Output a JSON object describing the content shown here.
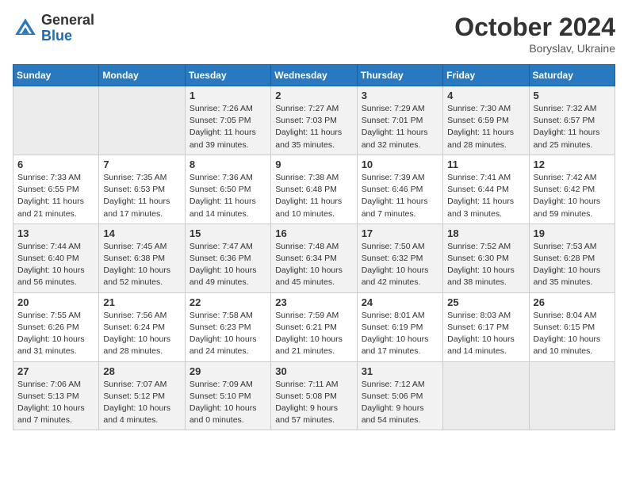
{
  "header": {
    "logo_general": "General",
    "logo_blue": "Blue",
    "month": "October 2024",
    "location": "Boryslav, Ukraine"
  },
  "weekdays": [
    "Sunday",
    "Monday",
    "Tuesday",
    "Wednesday",
    "Thursday",
    "Friday",
    "Saturday"
  ],
  "weeks": [
    [
      {
        "day": "",
        "info": ""
      },
      {
        "day": "",
        "info": ""
      },
      {
        "day": "1",
        "info": "Sunrise: 7:26 AM\nSunset: 7:05 PM\nDaylight: 11 hours and 39 minutes."
      },
      {
        "day": "2",
        "info": "Sunrise: 7:27 AM\nSunset: 7:03 PM\nDaylight: 11 hours and 35 minutes."
      },
      {
        "day": "3",
        "info": "Sunrise: 7:29 AM\nSunset: 7:01 PM\nDaylight: 11 hours and 32 minutes."
      },
      {
        "day": "4",
        "info": "Sunrise: 7:30 AM\nSunset: 6:59 PM\nDaylight: 11 hours and 28 minutes."
      },
      {
        "day": "5",
        "info": "Sunrise: 7:32 AM\nSunset: 6:57 PM\nDaylight: 11 hours and 25 minutes."
      }
    ],
    [
      {
        "day": "6",
        "info": "Sunrise: 7:33 AM\nSunset: 6:55 PM\nDaylight: 11 hours and 21 minutes."
      },
      {
        "day": "7",
        "info": "Sunrise: 7:35 AM\nSunset: 6:53 PM\nDaylight: 11 hours and 17 minutes."
      },
      {
        "day": "8",
        "info": "Sunrise: 7:36 AM\nSunset: 6:50 PM\nDaylight: 11 hours and 14 minutes."
      },
      {
        "day": "9",
        "info": "Sunrise: 7:38 AM\nSunset: 6:48 PM\nDaylight: 11 hours and 10 minutes."
      },
      {
        "day": "10",
        "info": "Sunrise: 7:39 AM\nSunset: 6:46 PM\nDaylight: 11 hours and 7 minutes."
      },
      {
        "day": "11",
        "info": "Sunrise: 7:41 AM\nSunset: 6:44 PM\nDaylight: 11 hours and 3 minutes."
      },
      {
        "day": "12",
        "info": "Sunrise: 7:42 AM\nSunset: 6:42 PM\nDaylight: 10 hours and 59 minutes."
      }
    ],
    [
      {
        "day": "13",
        "info": "Sunrise: 7:44 AM\nSunset: 6:40 PM\nDaylight: 10 hours and 56 minutes."
      },
      {
        "day": "14",
        "info": "Sunrise: 7:45 AM\nSunset: 6:38 PM\nDaylight: 10 hours and 52 minutes."
      },
      {
        "day": "15",
        "info": "Sunrise: 7:47 AM\nSunset: 6:36 PM\nDaylight: 10 hours and 49 minutes."
      },
      {
        "day": "16",
        "info": "Sunrise: 7:48 AM\nSunset: 6:34 PM\nDaylight: 10 hours and 45 minutes."
      },
      {
        "day": "17",
        "info": "Sunrise: 7:50 AM\nSunset: 6:32 PM\nDaylight: 10 hours and 42 minutes."
      },
      {
        "day": "18",
        "info": "Sunrise: 7:52 AM\nSunset: 6:30 PM\nDaylight: 10 hours and 38 minutes."
      },
      {
        "day": "19",
        "info": "Sunrise: 7:53 AM\nSunset: 6:28 PM\nDaylight: 10 hours and 35 minutes."
      }
    ],
    [
      {
        "day": "20",
        "info": "Sunrise: 7:55 AM\nSunset: 6:26 PM\nDaylight: 10 hours and 31 minutes."
      },
      {
        "day": "21",
        "info": "Sunrise: 7:56 AM\nSunset: 6:24 PM\nDaylight: 10 hours and 28 minutes."
      },
      {
        "day": "22",
        "info": "Sunrise: 7:58 AM\nSunset: 6:23 PM\nDaylight: 10 hours and 24 minutes."
      },
      {
        "day": "23",
        "info": "Sunrise: 7:59 AM\nSunset: 6:21 PM\nDaylight: 10 hours and 21 minutes."
      },
      {
        "day": "24",
        "info": "Sunrise: 8:01 AM\nSunset: 6:19 PM\nDaylight: 10 hours and 17 minutes."
      },
      {
        "day": "25",
        "info": "Sunrise: 8:03 AM\nSunset: 6:17 PM\nDaylight: 10 hours and 14 minutes."
      },
      {
        "day": "26",
        "info": "Sunrise: 8:04 AM\nSunset: 6:15 PM\nDaylight: 10 hours and 10 minutes."
      }
    ],
    [
      {
        "day": "27",
        "info": "Sunrise: 7:06 AM\nSunset: 5:13 PM\nDaylight: 10 hours and 7 minutes."
      },
      {
        "day": "28",
        "info": "Sunrise: 7:07 AM\nSunset: 5:12 PM\nDaylight: 10 hours and 4 minutes."
      },
      {
        "day": "29",
        "info": "Sunrise: 7:09 AM\nSunset: 5:10 PM\nDaylight: 10 hours and 0 minutes."
      },
      {
        "day": "30",
        "info": "Sunrise: 7:11 AM\nSunset: 5:08 PM\nDaylight: 9 hours and 57 minutes."
      },
      {
        "day": "31",
        "info": "Sunrise: 7:12 AM\nSunset: 5:06 PM\nDaylight: 9 hours and 54 minutes."
      },
      {
        "day": "",
        "info": ""
      },
      {
        "day": "",
        "info": ""
      }
    ]
  ]
}
